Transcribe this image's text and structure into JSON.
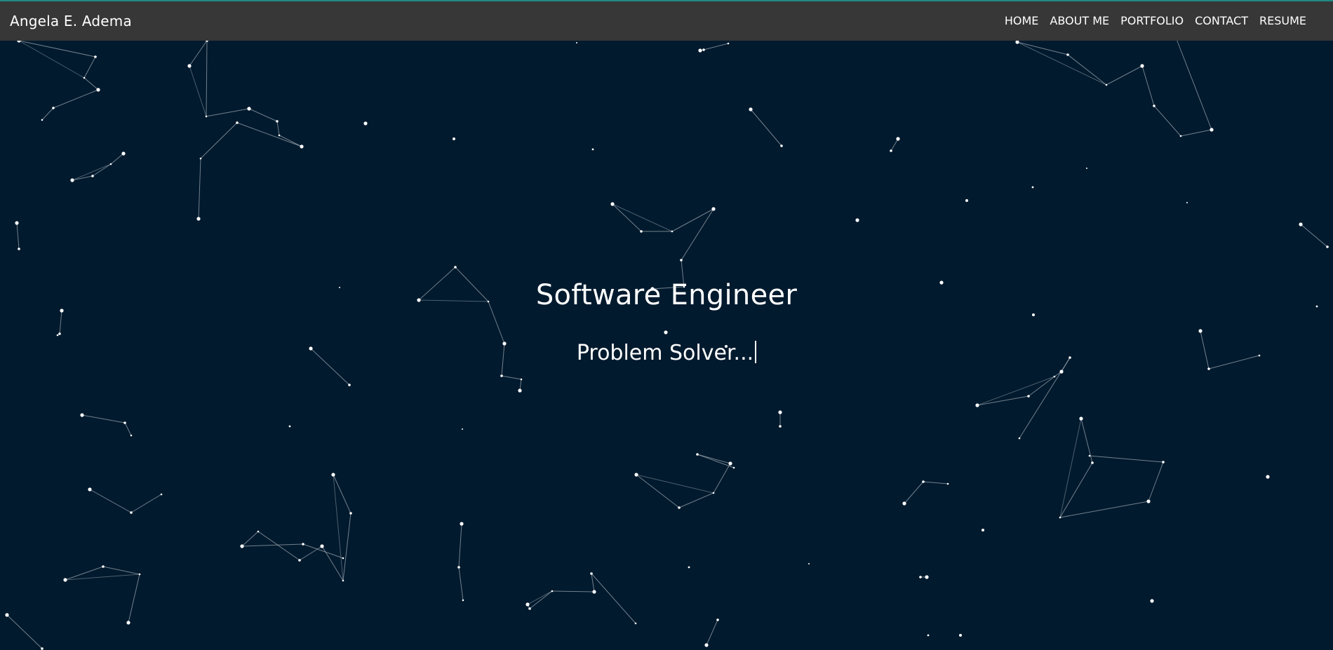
{
  "header": {
    "brand": "Angela E. Adema",
    "nav": [
      {
        "label": "HOME"
      },
      {
        "label": "ABOUT ME"
      },
      {
        "label": "PORTFOLIO"
      },
      {
        "label": "CONTACT"
      },
      {
        "label": "RESUME"
      }
    ]
  },
  "hero": {
    "title": "Software Engineer",
    "typed_text": "Problem Solver..."
  },
  "colors": {
    "background": "#011a2e",
    "navbar": "#373737",
    "accent": "#1f8a86",
    "text": "#ffffff",
    "particle": "#ffffff",
    "particle_link": "#9aa3ab"
  }
}
